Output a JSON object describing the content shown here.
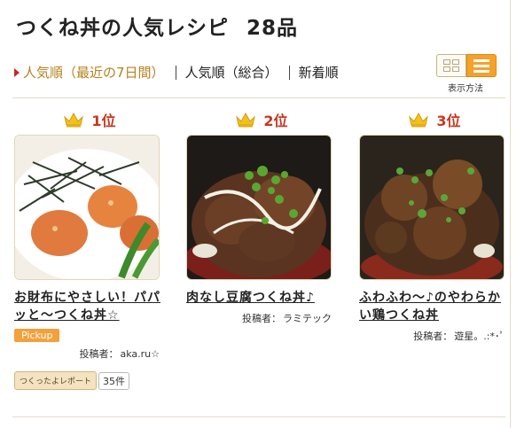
{
  "page": {
    "title": "つくね丼の人気レシピ",
    "count": "28品"
  },
  "sort": {
    "active": "人気順（最近の7日間）",
    "options": [
      "人気順（総合）",
      "新着順"
    ]
  },
  "view": {
    "label": "表示方法",
    "modes": [
      "grid",
      "list"
    ],
    "selected": "list"
  },
  "colors": {
    "accent": "#f6a12a",
    "rank": "#c7371f",
    "active_sort": "#b4811f",
    "crown": "#f3c21a"
  },
  "author_prefix": "投稿者：",
  "recipes": [
    {
      "rank": "1位",
      "title": "お財布にやさしい！パパッと〜つくね丼☆",
      "author": "aka.ru☆",
      "pickup": "Pickup",
      "report_label": "つくったよレポート",
      "report_count": "35件"
    },
    {
      "rank": "2位",
      "title": "肉なし豆腐つくね丼♪",
      "author": "ラミテック"
    },
    {
      "rank": "3位",
      "title": "ふわふわ〜♪のやわらかい鶏つくね丼",
      "author": "遊星。.:*･ﾟ"
    }
  ]
}
